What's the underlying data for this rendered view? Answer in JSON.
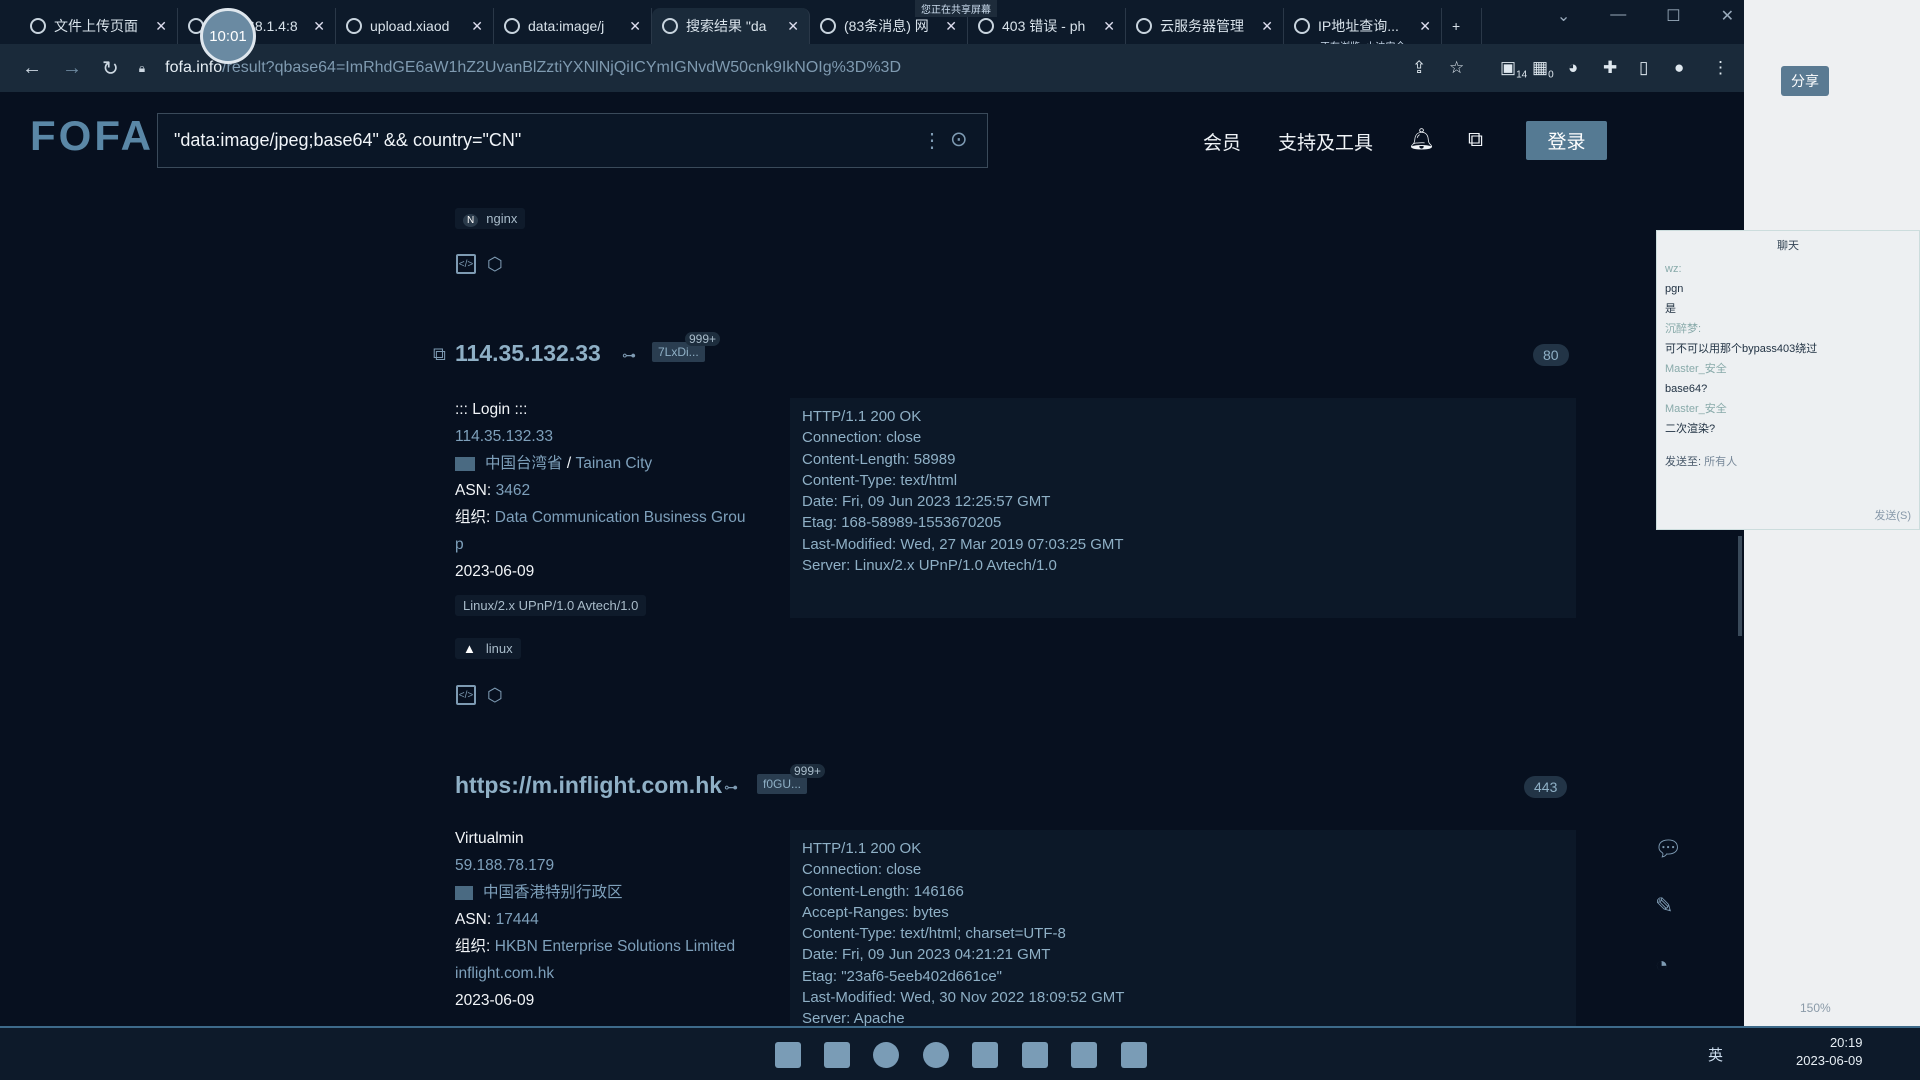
{
  "browser": {
    "tabs": [
      {
        "label": "文件上传页面"
      },
      {
        "label": "192.168.1.4:8"
      },
      {
        "label": "upload.xiaod"
      },
      {
        "label": "data:image/j"
      },
      {
        "label": "搜索结果 \"da",
        "active": true
      },
      {
        "label": "(83条消息) 网"
      },
      {
        "label": "403 错误 - ph"
      },
      {
        "label": "云服务器管理"
      },
      {
        "label": "IP地址查询..."
      }
    ],
    "sharing_banner": "您正在共享屏幕",
    "tab_status": "正在浏览: 小迪安全",
    "timer_overlay": "10:01",
    "url_host": "fofa.info",
    "url_path": "/result?qbase64=ImRhdGE6aW1hZ2UvanBlZztiYXNlNjQiICYmIGNvdW50cnk9IkNOIg%3D%3D",
    "ext_badges": {
      "a": "14",
      "b": "0"
    }
  },
  "header": {
    "logo": "FOFA",
    "search_value": "\"data:image/jpeg;base64\" && country=\"CN\"",
    "nav": [
      "会员",
      "支持及工具"
    ],
    "login": "登录"
  },
  "results": [
    {
      "partial": true,
      "tags": [
        {
          "icon": "N",
          "label": "nginx"
        }
      ]
    },
    {
      "title": "114.35.132.33",
      "hash_badge": "7LxDi...",
      "count": "999+",
      "port": "80",
      "site_title": "::: Login :::",
      "ip": "114.35.132.33",
      "location": "中国台湾省",
      "city": "Tainan City",
      "asn_label": "ASN:",
      "asn": "3462",
      "org_label": "组织:",
      "org": "Data Communication Business Grou",
      "org_wrap": "p",
      "date": "2023-06-09",
      "server_chip": "Linux/2.x UPnP/1.0 Avtech/1.0",
      "os": "linux",
      "response": [
        "HTTP/1.1 200 OK",
        "Connection: close",
        "Content-Length: 58989",
        "Content-Type: text/html",
        "Date: Fri, 09 Jun 2023 12:25:57 GMT",
        "Etag: 168-58989-1553670205",
        "Last-Modified: Wed, 27 Mar 2019 07:03:25 GMT",
        "Server: Linux/2.x UPnP/1.0 Avtech/1.0"
      ]
    },
    {
      "title": "https://m.inflight.com.hk",
      "hash_badge": "f0GU...",
      "count": "999+",
      "port": "443",
      "site_title": "Virtualmin",
      "ip": "59.188.78.179",
      "location": "中国香港特别行政区",
      "asn_label": "ASN:",
      "asn": "17444",
      "org_label": "组织:",
      "org": "HKBN Enterprise Solutions Limited",
      "domain": "inflight.com.hk",
      "date": "2023-06-09",
      "response": [
        "HTTP/1.1 200 OK",
        "Connection: close",
        "Content-Length: 146166",
        "Accept-Ranges: bytes",
        "Content-Type: text/html; charset=UTF-8",
        "Date: Fri, 09 Jun 2023 04:21:21 GMT",
        "Etag: \"23af6-5eeb402d661ce\"",
        "Last-Modified: Wed, 30 Nov 2022 18:09:52 GMT",
        "Server: Apache"
      ]
    }
  ],
  "side_app": {
    "share": "分享",
    "zoom": "150%"
  },
  "chat": {
    "title": "聊天",
    "messages": [
      {
        "name": "wz:",
        "text": "pgn"
      },
      {
        "name": "",
        "text": "是"
      },
      {
        "name": "沉醉梦:",
        "text": "可不可以用那个bypass403绕过"
      },
      {
        "name": "Master_安全",
        "text": "base64?"
      },
      {
        "name": "Master_安全",
        "text": "二次渲染?"
      }
    ],
    "send_to_label": "发送至:",
    "send_to_value": "所有人",
    "footer": "发送(S)"
  },
  "taskbar": {
    "time": "20:19",
    "date": "2023-06-09",
    "ime": "英"
  }
}
